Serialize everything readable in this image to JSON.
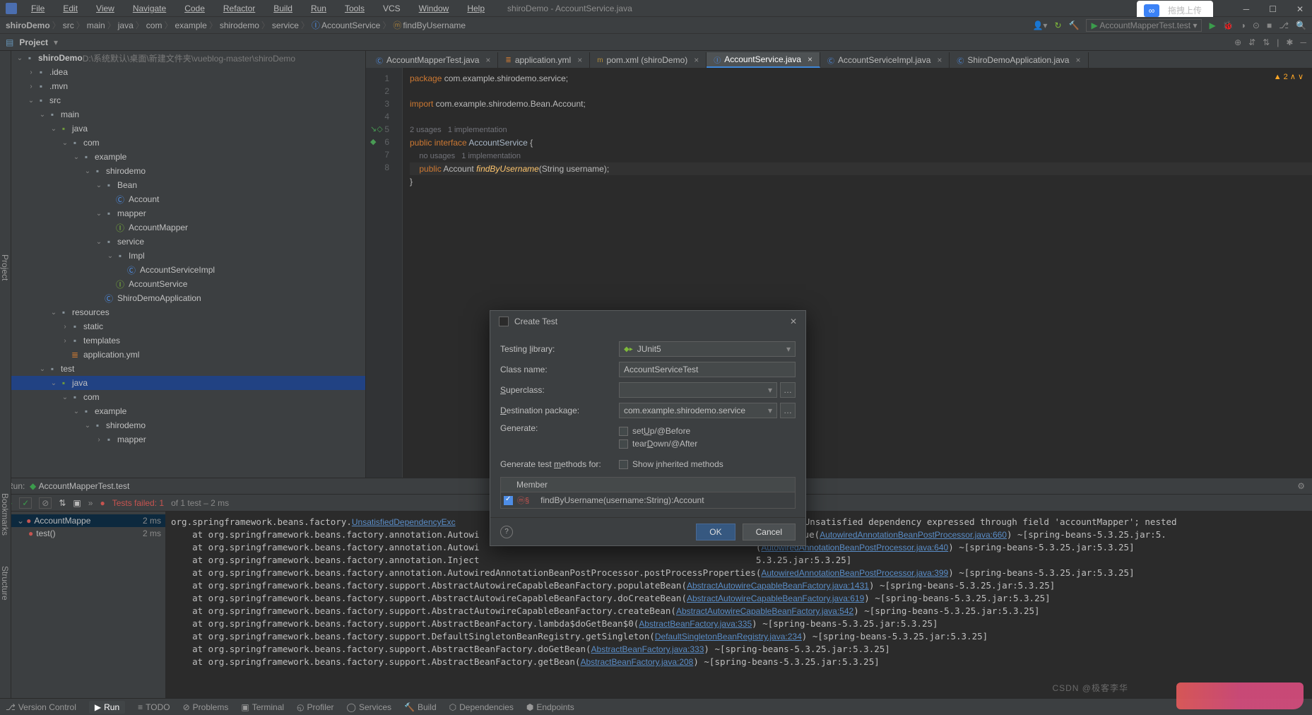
{
  "menu": {
    "items": [
      "File",
      "Edit",
      "View",
      "Navigate",
      "Code",
      "Refactor",
      "Build",
      "Run",
      "Tools",
      "VCS",
      "Window",
      "Help"
    ],
    "title": "shiroDemo - AccountService.java"
  },
  "upload": {
    "label": "拖拽上传"
  },
  "crumb": {
    "items": [
      "shiroDemo",
      "src",
      "main",
      "java",
      "com",
      "example",
      "shirodemo",
      "service",
      "AccountService",
      "findByUsername"
    ],
    "run_config": "AccountMapperTest.test"
  },
  "projectTool": {
    "title": "Project"
  },
  "tree": [
    {
      "d": 0,
      "exp": "v",
      "ico": "dir",
      "label": "shiroDemo",
      "suffix": " D:\\系统默认\\桌面\\新建文件夹\\vueblog-master\\shiroDemo",
      "bold": true
    },
    {
      "d": 1,
      "exp": ">",
      "ico": "dir",
      "label": ".idea"
    },
    {
      "d": 1,
      "exp": ">",
      "ico": "dir",
      "label": ".mvn"
    },
    {
      "d": 1,
      "exp": "v",
      "ico": "dir",
      "label": "src"
    },
    {
      "d": 2,
      "exp": "v",
      "ico": "dir",
      "label": "main"
    },
    {
      "d": 3,
      "exp": "v",
      "ico": "dir",
      "label": "java",
      "java": true
    },
    {
      "d": 4,
      "exp": "v",
      "ico": "pkg",
      "label": "com"
    },
    {
      "d": 5,
      "exp": "v",
      "ico": "pkg",
      "label": "example"
    },
    {
      "d": 6,
      "exp": "v",
      "ico": "pkg",
      "label": "shirodemo"
    },
    {
      "d": 7,
      "exp": "v",
      "ico": "pkg",
      "label": "Bean"
    },
    {
      "d": 8,
      "exp": "",
      "ico": "cls",
      "label": "Account"
    },
    {
      "d": 7,
      "exp": "v",
      "ico": "pkg",
      "label": "mapper"
    },
    {
      "d": 8,
      "exp": "",
      "ico": "int",
      "label": "AccountMapper"
    },
    {
      "d": 7,
      "exp": "v",
      "ico": "pkg",
      "label": "service"
    },
    {
      "d": 8,
      "exp": "v",
      "ico": "pkg",
      "label": "Impl"
    },
    {
      "d": 9,
      "exp": "",
      "ico": "cls",
      "label": "AccountServiceImpl"
    },
    {
      "d": 8,
      "exp": "",
      "ico": "int",
      "label": "AccountService"
    },
    {
      "d": 7,
      "exp": "",
      "ico": "cls",
      "label": "ShiroDemoApplication"
    },
    {
      "d": 3,
      "exp": "v",
      "ico": "dir",
      "label": "resources"
    },
    {
      "d": 4,
      "exp": ">",
      "ico": "dir",
      "label": "static"
    },
    {
      "d": 4,
      "exp": ">",
      "ico": "dir",
      "label": "templates"
    },
    {
      "d": 4,
      "exp": "",
      "ico": "yml",
      "label": "application.yml"
    },
    {
      "d": 2,
      "exp": "v",
      "ico": "dir",
      "label": "test"
    },
    {
      "d": 3,
      "exp": "v",
      "ico": "dir",
      "label": "java",
      "java": true,
      "sel": true
    },
    {
      "d": 4,
      "exp": "v",
      "ico": "pkg",
      "label": "com"
    },
    {
      "d": 5,
      "exp": "v",
      "ico": "pkg",
      "label": "example"
    },
    {
      "d": 6,
      "exp": "v",
      "ico": "pkg",
      "label": "shirodemo"
    },
    {
      "d": 7,
      "exp": ">",
      "ico": "pkg",
      "label": "mapper"
    }
  ],
  "tabs": [
    {
      "ico": "cls",
      "label": "AccountMapperTest.java"
    },
    {
      "ico": "yml",
      "label": "application.yml"
    },
    {
      "ico": "m",
      "label": "pom.xml (shiroDemo)"
    },
    {
      "ico": "int",
      "label": "AccountService.java",
      "active": true
    },
    {
      "ico": "cls",
      "label": "AccountServiceImpl.java"
    },
    {
      "ico": "cls",
      "label": "ShiroDemoApplication.java"
    }
  ],
  "editor": {
    "issues": "▲ 2 ∧ ∨",
    "lines": [
      {
        "n": 1,
        "html": "<span class='kw'>package</span> com.example.shirodemo.service;"
      },
      {
        "n": 2,
        "html": ""
      },
      {
        "n": 3,
        "html": "<span class='kw'>import</span> com.example.shirodemo.Bean.Account;"
      },
      {
        "n": 4,
        "html": ""
      },
      {
        "n": "",
        "html": "<span class='hint'>2 usages   1 implementation</span>"
      },
      {
        "n": 5,
        "html": "<span class='kw'>public interface</span> <span class='cl'>AccountService</span> {",
        "mark": "↘◇"
      },
      {
        "n": "",
        "html": "    <span class='hint'>no usages   1 implementation</span>"
      },
      {
        "n": 6,
        "html": "    <span class='kw'>public</span> Account <span class='meth'>findByUsername</span>(String username);",
        "cur": true,
        "mark": "◆"
      },
      {
        "n": 7,
        "html": "}"
      },
      {
        "n": 8,
        "html": ""
      }
    ]
  },
  "run": {
    "header": "AccountMapperTest.test",
    "fail": "Tests failed: 1",
    "fail_suffix": " of 1 test – 2 ms",
    "tree": [
      {
        "label": "AccountMappe",
        "dur": "2 ms",
        "sel": true
      },
      {
        "label": "test()",
        "dur": "2 ms"
      }
    ],
    "out": [
      "org.springframework.beans.factory.<span class='lnk'>UnsatisfiedDependencyExc</span>                                                     <span class='lnk'>ntServiceImpl</span>': Unsatisfied dependency expressed through field 'accountMapper'; nested",
      "    at org.springframework.beans.factory.annotation.Autowi                                                    eFieldValue(<span class='lnk'>AutowiredAnnotationBeanPostProcessor.java:660</span>) ~[spring-beans-5.3.25.jar:5.",
      "    at org.springframework.beans.factory.annotation.Autowi                                                    (<span class='lnk'>AutowiredAnnotationBeanPostProcessor.java:640</span>) ~[spring-beans-5.3.25.jar:5.3.25]",
      "    at org.springframework.beans.factory.annotation.Inject                                                    5.3.25.jar:5.3.25]",
      "    at org.springframework.beans.factory.annotation.AutowiredAnnotationBeanPostProcessor.postProcessProperties(<span class='lnk'>AutowiredAnnotationBeanPostProcessor.java:399</span>) ~[spring-beans-5.3.25.jar:5.3.25]",
      "    at org.springframework.beans.factory.support.AbstractAutowireCapableBeanFactory.populateBean(<span class='lnk'>AbstractAutowireCapableBeanFactory.java:1431</span>) ~[spring-beans-5.3.25.jar:5.3.25]",
      "    at org.springframework.beans.factory.support.AbstractAutowireCapableBeanFactory.doCreateBean(<span class='lnk'>AbstractAutowireCapableBeanFactory.java:619</span>) ~[spring-beans-5.3.25.jar:5.3.25]",
      "    at org.springframework.beans.factory.support.AbstractAutowireCapableBeanFactory.createBean(<span class='lnk'>AbstractAutowireCapableBeanFactory.java:542</span>) ~[spring-beans-5.3.25.jar:5.3.25]",
      "    at org.springframework.beans.factory.support.AbstractBeanFactory.lambda$doGetBean$0(<span class='lnk'>AbstractBeanFactory.java:335</span>) ~[spring-beans-5.3.25.jar:5.3.25]",
      "    at org.springframework.beans.factory.support.DefaultSingletonBeanRegistry.getSingleton(<span class='lnk'>DefaultSingletonBeanRegistry.java:234</span>) ~[spring-beans-5.3.25.jar:5.3.25]",
      "    at org.springframework.beans.factory.support.AbstractBeanFactory.doGetBean(<span class='lnk'>AbstractBeanFactory.java:333</span>) ~[spring-beans-5.3.25.jar:5.3.25]",
      "    at org.springframework.beans.factory.support.AbstractBeanFactory.getBean(<span class='lnk'>AbstractBeanFactory.java:208</span>) ~[spring-beans-5.3.25.jar:5.3.25]"
    ]
  },
  "bottom": {
    "items": [
      "Version Control",
      "Run",
      "TODO",
      "Problems",
      "Terminal",
      "Profiler",
      "Services",
      "Build",
      "Dependencies",
      "Endpoints"
    ]
  },
  "dialog": {
    "title": "Create Test",
    "rows": {
      "testlib": {
        "label": "Testing library:",
        "value": "JUnit5"
      },
      "classname": {
        "label": "Class name:",
        "value": "AccountServiceTest"
      },
      "superclass": {
        "label": "Superclass:",
        "value": ""
      },
      "destpkg": {
        "label": "Destination package:",
        "value": "com.example.shirodemo.service"
      },
      "generate": {
        "label": "Generate:",
        "opts": [
          "setUp/@Before",
          "tearDown/@After"
        ]
      },
      "genmethods": {
        "label": "Generate test methods for:",
        "opt": "Show inherited methods"
      },
      "memberhdr": "Member",
      "member": "findByUsername(username:String):Account"
    },
    "ok": "OK",
    "cancel": "Cancel"
  },
  "csdn": "CSDN @极客李华"
}
